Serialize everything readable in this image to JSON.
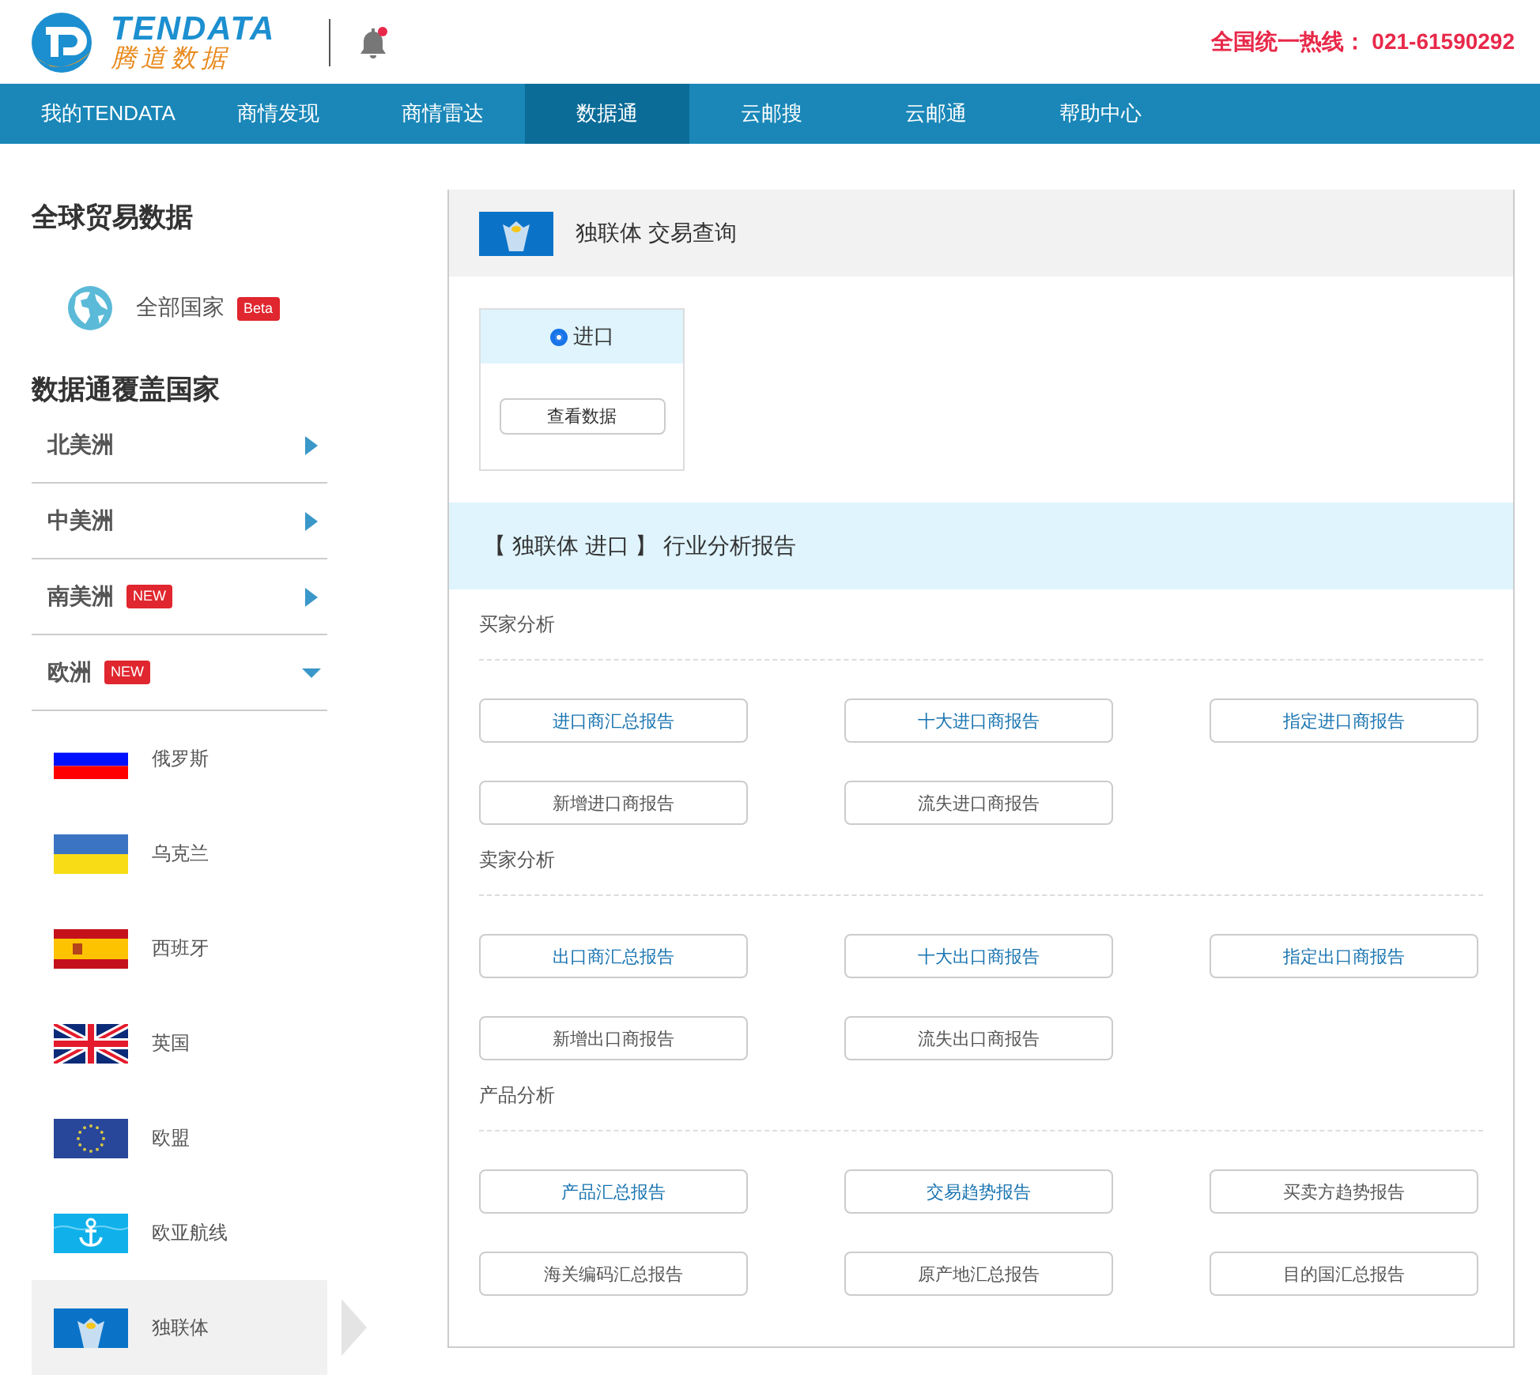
{
  "header": {
    "logo_text": "TENDATA",
    "logo_subtitle": "腾道数据",
    "hotline": "全国统一热线： 021-61590292",
    "notification": true
  },
  "nav": [
    {
      "label": "我的TENDATA",
      "selected": false
    },
    {
      "label": "商情发现",
      "selected": false
    },
    {
      "label": "商情雷达",
      "selected": false
    },
    {
      "label": "数据通",
      "selected": true
    },
    {
      "label": "云邮搜",
      "selected": false
    },
    {
      "label": "云邮通",
      "selected": false
    },
    {
      "label": "帮助中心",
      "selected": false
    }
  ],
  "sidebar": {
    "title": "全球贸易数据",
    "all_countries": {
      "label": "全部国家",
      "badge": "Beta"
    },
    "coverage_title": "数据通覆盖国家",
    "regions": [
      {
        "label": "北美洲",
        "expanded": false
      },
      {
        "label": "中美洲",
        "expanded": false
      },
      {
        "label": "南美洲",
        "badge": "NEW",
        "expanded": false
      },
      {
        "label": "欧洲",
        "badge": "NEW",
        "expanded": true,
        "children": [
          {
            "label": "俄罗斯",
            "selected": false
          },
          {
            "label": "乌克兰",
            "selected": false
          },
          {
            "label": "西班牙",
            "selected": false
          },
          {
            "label": "英国",
            "selected": false
          },
          {
            "label": "欧盟",
            "selected": false
          },
          {
            "label": "欧亚航线",
            "selected": false
          },
          {
            "label": "独联体",
            "selected": true
          }
        ]
      }
    ]
  },
  "main": {
    "title": "独联体 交易查询",
    "options": [
      {
        "label": "进口",
        "selected": true
      }
    ],
    "view_button": "查看数据",
    "report_title": "【 独联体 进口 】 行业分析报告",
    "sections": [
      {
        "title": "买家分析",
        "buttons": [
          {
            "label": "进口商汇总报告",
            "highlighted": true
          },
          {
            "label": "十大进口商报告",
            "highlighted": true
          },
          {
            "label": "指定进口商报告",
            "highlighted": true
          },
          {
            "label": "新增进口商报告",
            "highlighted": false
          },
          {
            "label": "流失进口商报告",
            "highlighted": false
          }
        ]
      },
      {
        "title": "卖家分析",
        "buttons": [
          {
            "label": "出口商汇总报告",
            "highlighted": true
          },
          {
            "label": "十大出口商报告",
            "highlighted": true
          },
          {
            "label": "指定出口商报告",
            "highlighted": true
          },
          {
            "label": "新增出口商报告",
            "highlighted": false
          },
          {
            "label": "流失出口商报告",
            "highlighted": false
          }
        ]
      },
      {
        "title": "产品分析",
        "buttons": [
          {
            "label": "产品汇总报告",
            "highlighted": true
          },
          {
            "label": "交易趋势报告",
            "highlighted": true
          },
          {
            "label": "买卖方趋势报告",
            "highlighted": false
          },
          {
            "label": "海关编码汇总报告",
            "highlighted": false
          },
          {
            "label": "原产地汇总报告",
            "highlighted": false
          },
          {
            "label": "目的国汇总报告",
            "highlighted": false
          }
        ]
      }
    ]
  }
}
